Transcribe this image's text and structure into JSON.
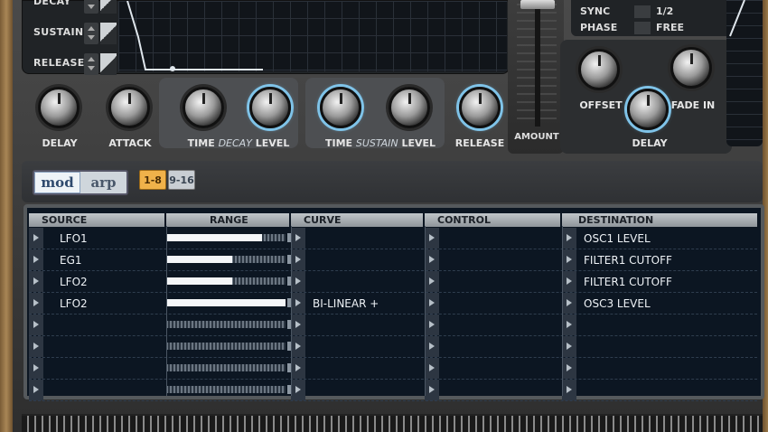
{
  "envelope": {
    "rows": [
      {
        "label": "DECAY"
      },
      {
        "label": "SUSTAIN"
      },
      {
        "label": "RELEASE"
      }
    ],
    "knobs": [
      {
        "label": "DELAY"
      },
      {
        "label": "ATTACK"
      },
      {
        "label": "TIME"
      },
      {
        "label": "LEVEL"
      },
      {
        "label": "TIME"
      },
      {
        "label": "LEVEL"
      },
      {
        "label": "RELEASE"
      }
    ],
    "decay_label": "DECAY",
    "sustain_label": "SUSTAIN"
  },
  "amount": {
    "label": "AMOUNT"
  },
  "lfo": {
    "sync": {
      "label": "SYNC",
      "value": "1/2"
    },
    "phase": {
      "label": "PHASE",
      "value": "FREE"
    },
    "knobs": [
      {
        "label": "OFFSET"
      },
      {
        "label": "FADE IN"
      },
      {
        "label": "DELAY"
      }
    ]
  },
  "tabs": {
    "mod": "mod",
    "arp": "arp",
    "active": "mod",
    "page_1": "1-8",
    "page_2": "9-16"
  },
  "matrix": {
    "headers": {
      "source": "SOURCE",
      "range": "RANGE",
      "curve": "CURVE",
      "control": "CONTROL",
      "destination": "DESTINATION"
    },
    "rows": [
      {
        "source": "LFO1",
        "range": 0.8,
        "curve": "",
        "control": "",
        "destination": "OSC1 LEVEL"
      },
      {
        "source": "EG1",
        "range": 0.55,
        "curve": "",
        "control": "",
        "destination": "FILTER1 CUTOFF"
      },
      {
        "source": "LFO2",
        "range": 0.55,
        "curve": "",
        "control": "",
        "destination": "FILTER1 CUTOFF"
      },
      {
        "source": "LFO2",
        "range": 1.0,
        "curve": "BI-LINEAR +",
        "control": "",
        "destination": "OSC3 LEVEL"
      },
      {
        "source": "",
        "range": 0,
        "curve": "",
        "control": "",
        "destination": ""
      },
      {
        "source": "",
        "range": 0,
        "curve": "",
        "control": "",
        "destination": ""
      },
      {
        "source": "",
        "range": 0,
        "curve": "",
        "control": "",
        "destination": ""
      },
      {
        "source": "",
        "range": 0,
        "curve": "",
        "control": "",
        "destination": ""
      }
    ]
  }
}
